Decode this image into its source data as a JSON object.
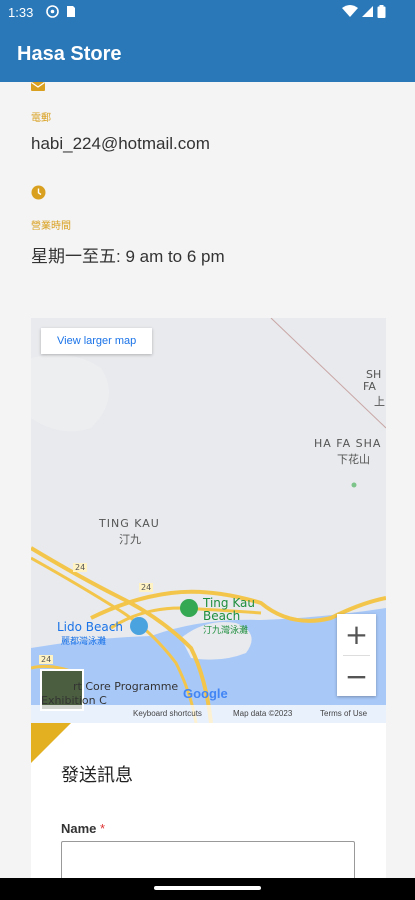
{
  "status": {
    "time": "1:33"
  },
  "app": {
    "title": "Hasa Store"
  },
  "contact": {
    "email_label": "電郵",
    "email_value": "habi_224@hotmail.com",
    "hours_label": "營業時間",
    "hours_value": "星期一至五: 9 am to 6 pm"
  },
  "map": {
    "view_larger": "View larger map",
    "places": {
      "ting_kau": "TING KAU",
      "ting_kau_zh": "汀九",
      "ha_fa_shan": "HA FA SHA",
      "ha_fa_shan_zh": "下花山",
      "sh_fa_1": "SH",
      "sh_fa_2": "FA",
      "sh_fa_zh": "上",
      "ting_kau_beach": "Ting Kau",
      "ting_kau_beach_2": "Beach",
      "ting_kau_beach_zh": "汀九灣泳灘",
      "lido_beach": "Lido Beach",
      "lido_beach_zh": "麗都灣泳灘",
      "programme": "rt Core Programme",
      "exhibition": "Exhibition C",
      "route_24a": "24",
      "route_24b": "24",
      "route_24c": "24"
    },
    "google": "Google",
    "shortcuts": "Keyboard shortcuts",
    "map_data": "Map data ©2023",
    "terms": "Terms of Use",
    "zoom_in": "+",
    "zoom_out": "−"
  },
  "form": {
    "title": "發送訊息",
    "name_label": "Name",
    "required_mark": "*"
  },
  "colors": {
    "appbar": "#2a78b8",
    "accent": "#d9a020"
  }
}
